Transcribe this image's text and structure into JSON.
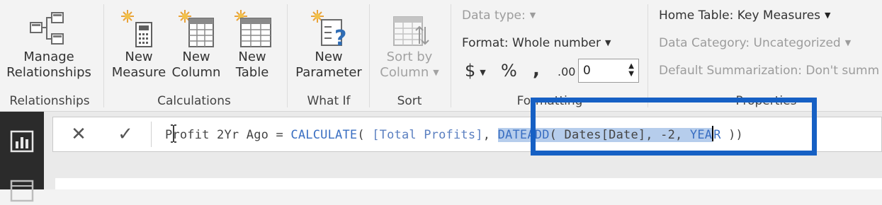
{
  "ribbon": {
    "relationships": {
      "group_label": "Relationships",
      "manage_line1": "Manage",
      "manage_line2": "Relationships"
    },
    "calculations": {
      "group_label": "Calculations",
      "new_measure_line1": "New",
      "new_measure_line2": "Measure",
      "new_column_line1": "New",
      "new_column_line2": "Column",
      "new_table_line1": "New",
      "new_table_line2": "Table"
    },
    "what_if": {
      "group_label": "What If",
      "new_parameter_line1": "New",
      "new_parameter_line2": "Parameter"
    },
    "sort": {
      "group_label": "Sort",
      "sort_line1": "Sort by",
      "sort_line2": "Column"
    },
    "formatting": {
      "group_label": "Formatting",
      "data_type": "Data type:",
      "format": "Format: Whole number",
      "currency_symbol": "$",
      "percent_symbol": "%",
      "comma_symbol": ",",
      "decimal_symbol": ".00",
      "decimal_places": "0"
    },
    "properties": {
      "group_label": "Properties",
      "home_table": "Home Table: Key Measures",
      "data_category": "Data Category: Uncategorized",
      "default_summarization": "Default Summarization: Don't summ"
    }
  },
  "formula_bar": {
    "cancel_glyph": "✕",
    "commit_glyph": "✓",
    "formula": {
      "part1": "Profit 2Yr Ago = ",
      "part2": "CALCULATE",
      "part3": "( ",
      "part4": "[Total Profits]",
      "part5": ", ",
      "sel_func": "DATEADD",
      "sel_rest": "( Dates[Date], -2, ",
      "sel_year": "YEA",
      "after_cursor_year": "R",
      "tail": " ))"
    }
  },
  "colors": {
    "highlight_border": "#1660c4",
    "keyword": "#3a6fc2",
    "selection": "#b6cdec",
    "left_rail": "#2b2b2b"
  },
  "icons": [
    "manage-relationships-icon",
    "new-measure-icon",
    "new-column-icon",
    "new-table-icon",
    "new-parameter-icon",
    "sort-by-column-icon",
    "report-view-icon",
    "data-view-icon",
    "cancel-icon",
    "commit-icon"
  ]
}
